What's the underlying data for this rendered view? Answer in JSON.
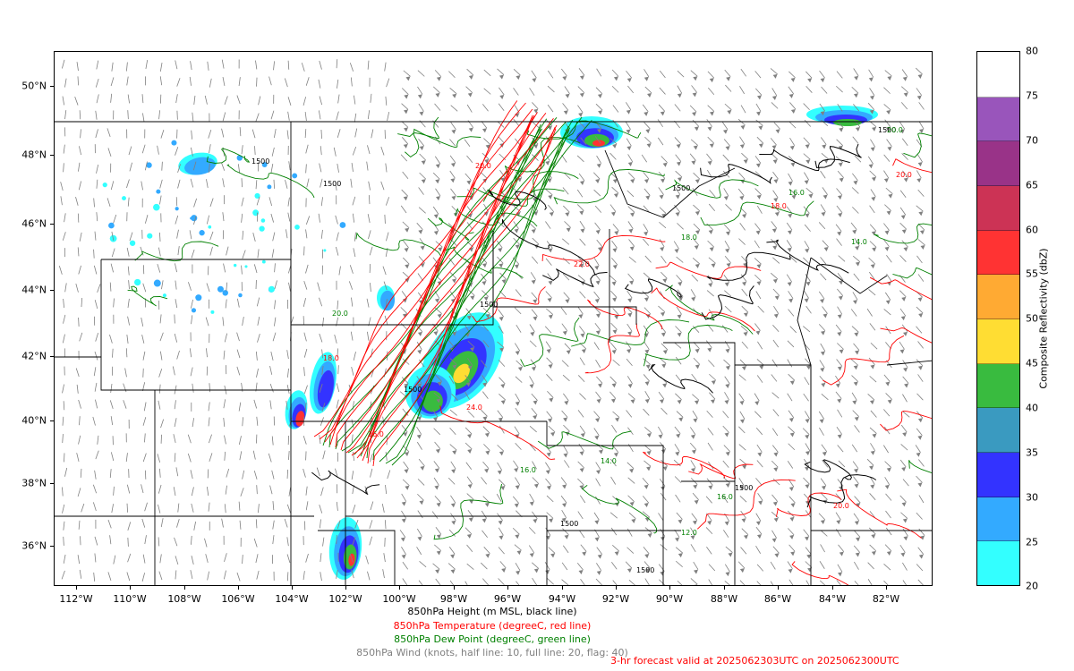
{
  "map": {
    "latitude_labels": [
      "50°N",
      "48°N",
      "46°N",
      "44°N",
      "42°N",
      "40°N",
      "38°N",
      "36°N"
    ],
    "longitude_labels": [
      "112°W",
      "110°W",
      "108°W",
      "106°W",
      "104°W",
      "102°W",
      "100°W",
      "98°W",
      "96°W",
      "94°W",
      "92°W",
      "90°W",
      "88°W",
      "86°W",
      "84°W",
      "82°W"
    ],
    "extent": {
      "lon_min": -113.0,
      "lon_max": -80.6,
      "lat_min": 34.7,
      "lat_max": 51.0
    },
    "height_contour_label": "1500",
    "temperature_contour_labels": [
      "20.0",
      "22.0",
      "24.0",
      "26.0",
      "18.0"
    ],
    "dewpoint_contour_labels": [
      "14.0",
      "16.0",
      "18.0",
      "12.0",
      "20.0"
    ],
    "colors": {
      "height_line": "#000000",
      "temperature_line": "#ff0000",
      "dewpoint_line": "#008000",
      "wind_barb": "#808080"
    }
  },
  "colorbar": {
    "title": "Composite Reflectivity (dbZ)",
    "tick_labels": [
      "80",
      "75",
      "70",
      "65",
      "60",
      "55",
      "50",
      "45",
      "40",
      "35",
      "30",
      "25",
      "20"
    ],
    "bins": [
      {
        "from": 20,
        "to": 25,
        "color": "#33ffff"
      },
      {
        "from": 25,
        "to": 30,
        "color": "#33aaff"
      },
      {
        "from": 30,
        "to": 35,
        "color": "#3333ff"
      },
      {
        "from": 35,
        "to": 40,
        "color": "#3a9ac0"
      },
      {
        "from": 40,
        "to": 45,
        "color": "#39bb3f"
      },
      {
        "from": 45,
        "to": 50,
        "color": "#ffdd33"
      },
      {
        "from": 50,
        "to": 55,
        "color": "#ffaa33"
      },
      {
        "from": 55,
        "to": 60,
        "color": "#ff3333"
      },
      {
        "from": 60,
        "to": 65,
        "color": "#cc3355"
      },
      {
        "from": 65,
        "to": 70,
        "color": "#993388"
      },
      {
        "from": 70,
        "to": 75,
        "color": "#9955bb"
      },
      {
        "from": 75,
        "to": 80,
        "color": "#ffffff"
      }
    ]
  },
  "legend": {
    "height": "850hPa Height (m MSL, black line)",
    "temperature": "850hPa Temperature (degreeC, red line)",
    "dewpoint": "850hPa Dew Point (degreeC, green line)",
    "wind": "850hPa Wind (knots, half line: 10, full line: 20, flag: 40)",
    "valid": "3-hr forecast valid at 2025062303UTC on 2025062300UTC",
    "colors": {
      "height": "#000000",
      "temperature": "#ff0000",
      "dewpoint": "#008000",
      "wind": "#808080",
      "valid": "#ff0000"
    }
  }
}
